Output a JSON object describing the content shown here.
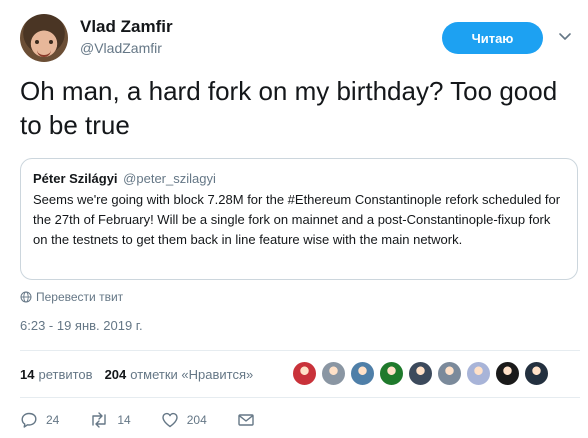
{
  "author": {
    "display_name": "Vlad Zamfir",
    "handle": "@VladZamfir"
  },
  "follow_button_label": "Читаю",
  "tweet_text": "Oh man, a hard fork on my birthday? Too good to be true",
  "quoted_tweet": {
    "author_name": "Péter Szilágyi",
    "author_handle": "@peter_szilagyi",
    "text": "Seems we're going with block 7.28M for the #Ethereum Constantinople refork scheduled for the 27th of February! Will be a single fork on mainnet and a post-Constantinople-fixup fork on the testnets to get them back in line feature wise with the main network."
  },
  "translate_label": "Перевести твит",
  "timestamp": "6:23 - 19 янв. 2019 г.",
  "stats": {
    "retweets_count": "14",
    "retweets_label": "ретвитов",
    "likes_count": "204",
    "likes_label": "отметки «Нравится»"
  },
  "likers_avatar_colors": [
    "#c9323a",
    "#8a96a3",
    "#4f7fa8",
    "#1f7a2c",
    "#3c4a5c",
    "#7b8a9b",
    "#a8b4d8",
    "#1a1a1a",
    "#23303f"
  ],
  "actions": {
    "replies": "24",
    "retweets": "14",
    "likes": "204"
  },
  "colors": {
    "accent": "#1da1f2",
    "secondary_text": "#657786",
    "border": "#ccd6dd"
  }
}
